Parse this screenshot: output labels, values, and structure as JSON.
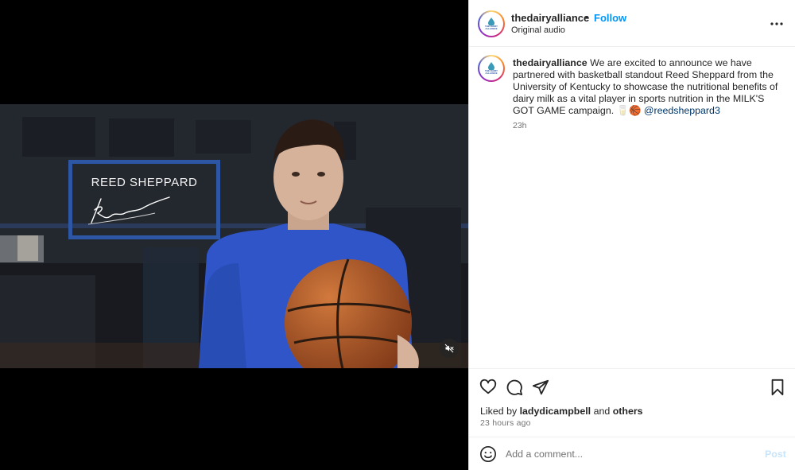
{
  "video": {
    "name_card": "REED SHEPPARD",
    "mute_icon": "speaker-muted-icon"
  },
  "header": {
    "username": "thedairyalliance",
    "separator": "•",
    "follow_label": "Follow",
    "subtitle": "Original audio",
    "avatar_label": "THE DAIRY ALLIANCE",
    "more_icon": "more-horizontal-icon"
  },
  "caption": {
    "username": "thedairyalliance",
    "text": " We are excited to announce we have partnered with basketball standout Reed Sheppard from the University of Kentucky to showcase the nutritional benefits of dairy milk as a vital player in sports nutrition in the MILK'S GOT GAME campaign. 🥛🏀 ",
    "mention": "@reedsheppard3",
    "time": "23h"
  },
  "actions": {
    "like_icon": "heart-icon",
    "comment_icon": "comment-icon",
    "share_icon": "send-icon",
    "save_icon": "bookmark-icon",
    "liked_prefix": "Liked by ",
    "liked_user": "ladydicampbell",
    "liked_and": " and ",
    "liked_others": "others",
    "time_ago": "23 hours ago"
  },
  "comment": {
    "emoji_icon": "smiley-icon",
    "placeholder": "Add a comment...",
    "post_label": "Post"
  },
  "colors": {
    "accent": "#0095f6",
    "mention": "#00376b",
    "card_border": "#2d56a4",
    "post_disabled": "#c7e5fc"
  }
}
